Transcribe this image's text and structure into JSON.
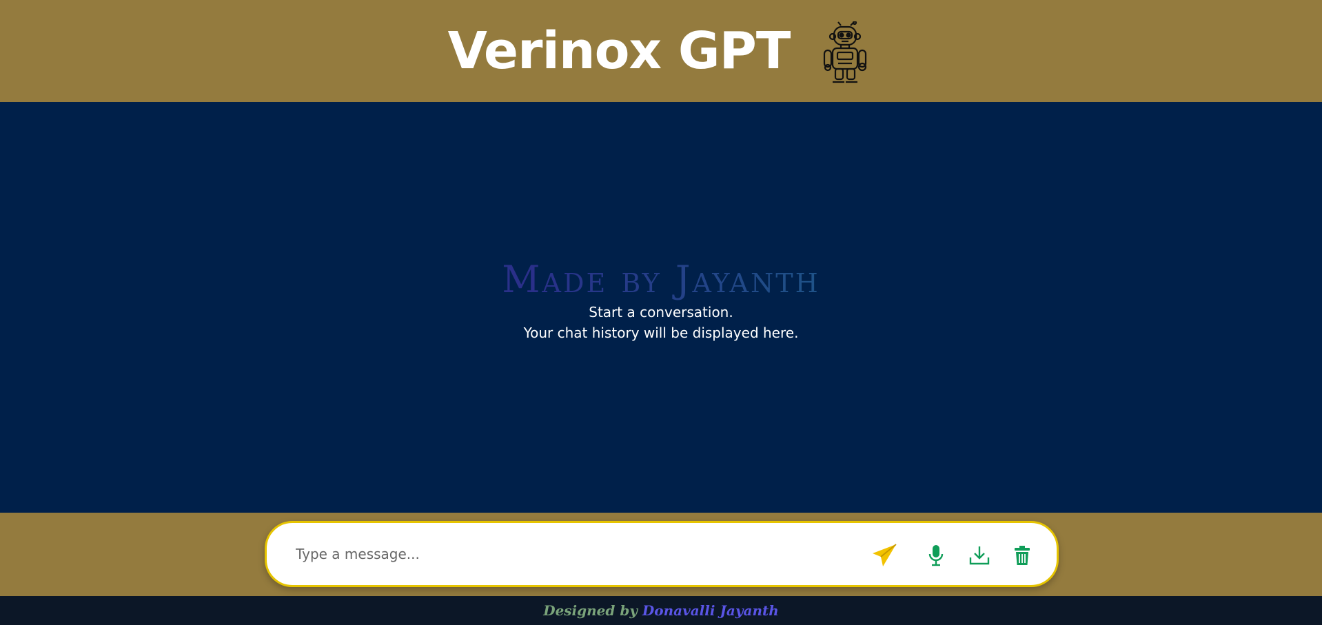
{
  "header": {
    "title": "Verinox GPT",
    "logo_icon": "robot-icon",
    "background": "#947b3e"
  },
  "chat": {
    "background": "#00204a",
    "watermark": "Made by Jayanth",
    "empty_line_1": "Start a conversation.",
    "empty_line_2": "Your chat history will be displayed here."
  },
  "composer": {
    "placeholder": "Type a message...",
    "value": "",
    "border_color": "#e6c400",
    "buttons": [
      {
        "name": "send",
        "icon": "paper-plane-icon",
        "color": "#f2c200"
      },
      {
        "name": "microphone",
        "icon": "microphone-icon",
        "color": "#0f9d58"
      },
      {
        "name": "download",
        "icon": "download-icon",
        "color": "#0f9d58"
      },
      {
        "name": "delete",
        "icon": "trash-icon",
        "color": "#0f9d58"
      }
    ]
  },
  "footer": {
    "prefix": "Designed by",
    "author": "Donavalli Jayanth",
    "background": "#0c1727"
  }
}
